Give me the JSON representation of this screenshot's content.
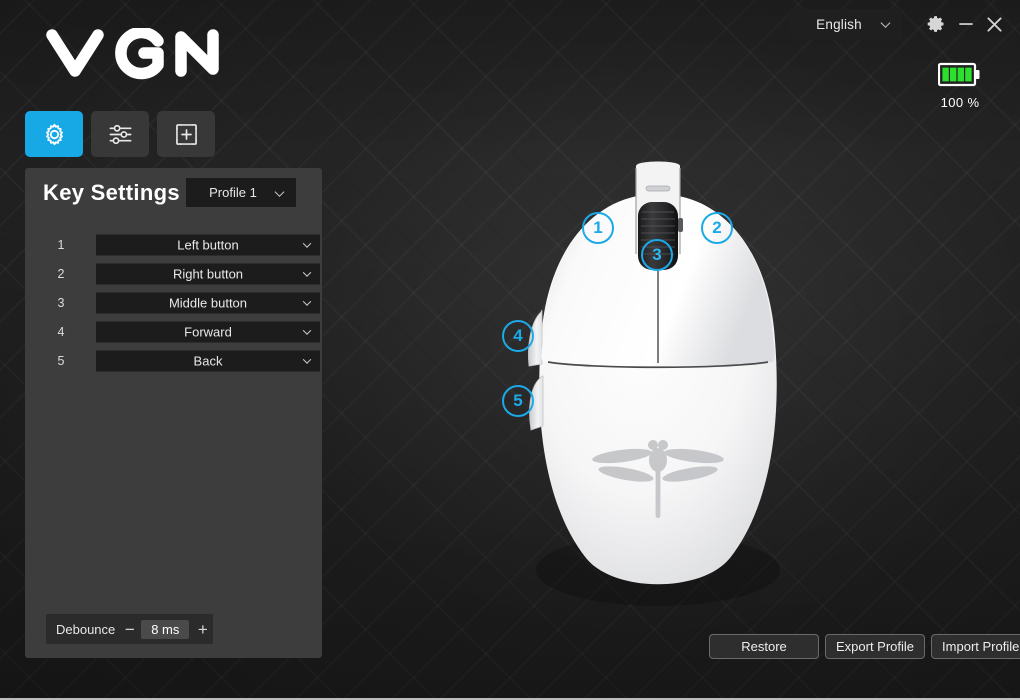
{
  "window": {
    "brand_logo": "VGN",
    "language": {
      "value": "English",
      "icon": "chevron-down-icon"
    },
    "controls": {
      "settings": "gear-icon",
      "minimize": "minimize-icon",
      "close": "close-icon"
    }
  },
  "battery": {
    "percent_label": "100 %",
    "level": 100,
    "bars": 4,
    "color": "#2ee02e"
  },
  "nav": {
    "tabs": [
      {
        "name": "key-settings",
        "icon": "gear-icon",
        "active": true
      },
      {
        "name": "performance",
        "icon": "sliders-icon",
        "active": false
      },
      {
        "name": "add-profile",
        "icon": "plus-square-icon",
        "active": false
      }
    ],
    "active_color": "#17A8E6"
  },
  "panel": {
    "title": "Key Settings",
    "profile": {
      "value": "Profile 1",
      "icon": "chevron-down-icon"
    },
    "key_rows": [
      {
        "index": "1",
        "value": "Left button"
      },
      {
        "index": "2",
        "value": "Right button"
      },
      {
        "index": "3",
        "value": "Middle button"
      },
      {
        "index": "4",
        "value": "Forward"
      },
      {
        "index": "5",
        "value": "Back"
      }
    ],
    "debounce": {
      "label": "Debounce",
      "minus": "−",
      "value": "8 ms",
      "plus": "+"
    }
  },
  "mouse": {
    "callouts": [
      {
        "number": "1",
        "maps_to": "Left button"
      },
      {
        "number": "2",
        "maps_to": "Right button"
      },
      {
        "number": "3",
        "maps_to": "Middle button"
      },
      {
        "number": "4",
        "maps_to": "Forward"
      },
      {
        "number": "5",
        "maps_to": "Back"
      }
    ],
    "logo": "dragonfly-logo",
    "accent_color": "#1BA9E8"
  },
  "actions": [
    {
      "name": "restore",
      "label": "Restore"
    },
    {
      "name": "export-profile",
      "label": "Export Profile"
    },
    {
      "name": "import-profile",
      "label": "Import Profile"
    }
  ]
}
